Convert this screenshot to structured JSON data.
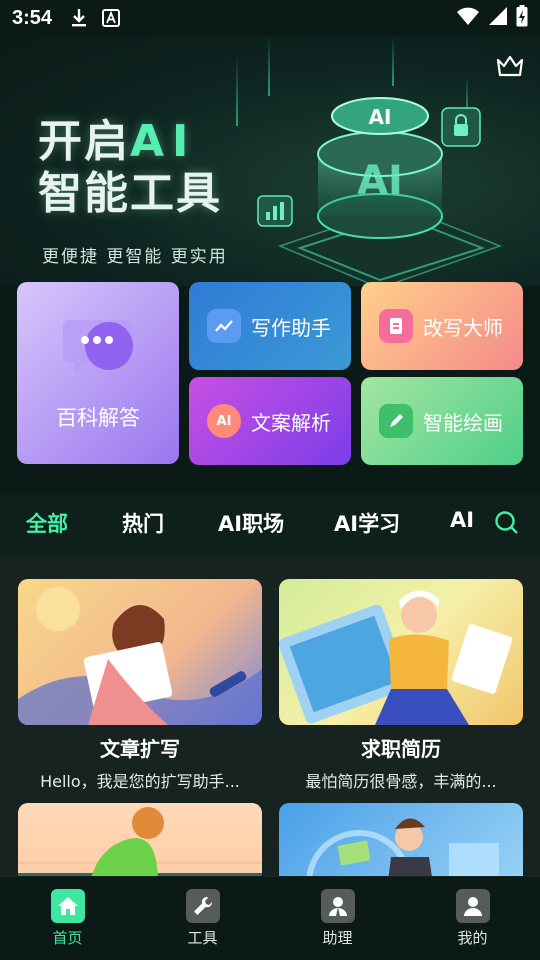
{
  "status_bar": {
    "time": "3:54"
  },
  "hero": {
    "title_line1_prefix": "开启",
    "title_line1_ai": "AI",
    "title_line2": "智能工具",
    "subtitle": "更便捷  更智能  更实用",
    "art_text": "AI"
  },
  "tools": {
    "encyclopedia": "百科解答",
    "writing": "写作助手",
    "rewrite": "改写大师",
    "copy_analysis": "文案解析",
    "smart_drawing": "智能绘画"
  },
  "tabs": [
    {
      "label": "全部",
      "active": true
    },
    {
      "label": "热门"
    },
    {
      "label": "AI职场"
    },
    {
      "label": "AI学习"
    },
    {
      "label": "AI"
    }
  ],
  "cards": [
    {
      "title": "文章扩写",
      "desc": "Hello，我是您的扩写助手..."
    },
    {
      "title": "求职简历",
      "desc": "最怕简历很骨感，丰满的..."
    },
    {
      "title": "",
      "desc": ""
    },
    {
      "title": "",
      "desc": ""
    }
  ],
  "bottom_nav": [
    {
      "label": "首页",
      "icon": "home-icon",
      "active": true
    },
    {
      "label": "工具",
      "icon": "wrench-icon"
    },
    {
      "label": "助理",
      "icon": "assistant-icon"
    },
    {
      "label": "我的",
      "icon": "user-icon"
    }
  ],
  "colors": {
    "accent": "#3ff0a5",
    "background": "#0b1a17"
  }
}
